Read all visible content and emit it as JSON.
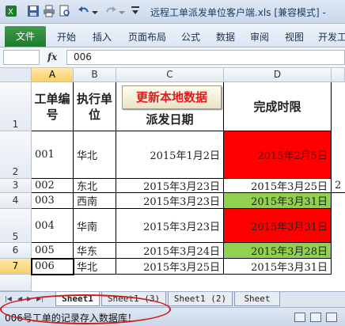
{
  "window": {
    "title": "远程工单派发单位客户端.xls  [兼容模式] -"
  },
  "ribbon": {
    "file_label": "文件",
    "tabs": [
      "开始",
      "插入",
      "页面布局",
      "公式",
      "数据",
      "审阅",
      "视图",
      "开发工"
    ]
  },
  "formula_bar": {
    "fx_label": "fx",
    "value": "006"
  },
  "columns": [
    "A",
    "B",
    "C",
    "D"
  ],
  "rows": [
    "1",
    "2",
    "3",
    "4",
    "5",
    "6",
    "7"
  ],
  "button": {
    "update_label": "更新本地数据"
  },
  "table": {
    "headers": {
      "a": "工单编号",
      "b": "执行单位",
      "c": "派发日期",
      "d": "完成时限"
    },
    "records": [
      {
        "a": "001",
        "b": "华北",
        "c": "2015年1月2日",
        "d": "2015年2月5日"
      },
      {
        "a": "002",
        "b": "东北",
        "c": "2015年3月23日",
        "d": "2015年3月25日",
        "e": "2"
      },
      {
        "a": "003",
        "b": "西南",
        "c": "2015年3月23日",
        "d": "2015年3月31日"
      },
      {
        "a": "004",
        "b": "华南",
        "c": "2015年3月23日",
        "d": "2015年3月31日"
      },
      {
        "a": "005",
        "b": "华东",
        "c": "2015年3月24日",
        "d": "2015年3月28日"
      },
      {
        "a": "006",
        "b": "华北",
        "c": "2015年3月25日",
        "d": "2015年3月31日"
      }
    ]
  },
  "sheet_tabs": [
    "Sheet1",
    "Sheet1 (3)",
    "Sheet1 (2)",
    "Sheet"
  ],
  "status": {
    "message": "006号工单的记录存入数据库！"
  },
  "colors": {
    "overdue": "#ff0000",
    "ok": "#92d050",
    "annotation": "#d11a1a"
  }
}
